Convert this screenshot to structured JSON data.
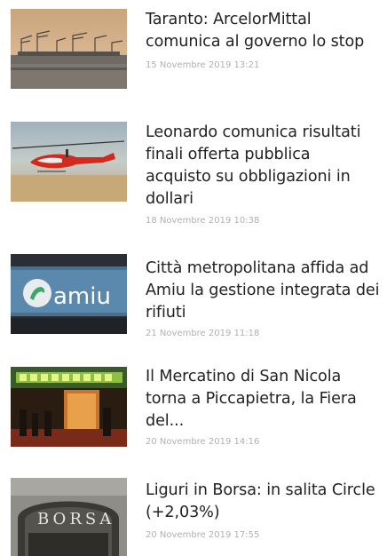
{
  "articles": [
    {
      "title": "Taranto: ArcelorMittal comunica al governo lo stop",
      "date": "15 Novembre 2019 13:21",
      "image": "industrial-port-cranes-photo"
    },
    {
      "title": "Leonardo comunica risultati finali offerta pubblica acquisto su obbligazioni in dollari",
      "date": "18 Novembre 2019 10:38",
      "image": "red-helicopter-photo"
    },
    {
      "title": "Città metropolitana affida ad Amiu la gestione integrata dei rifiuti",
      "date": "21 Novembre 2019 11:18",
      "image": "amiu-logo-photo",
      "image_text": "amiu"
    },
    {
      "title": "Il Mercatino di San Nicola torna a Piccapietra, la Fiera del...",
      "date": "20 Novembre 2019 14:16",
      "image": "christmas-market-photo"
    },
    {
      "title": "Liguri in Borsa: in salita Circle (+2,03%)",
      "date": "20 Novembre 2019 17:55",
      "image": "borsa-building-photo",
      "image_text": "BORSA"
    }
  ]
}
